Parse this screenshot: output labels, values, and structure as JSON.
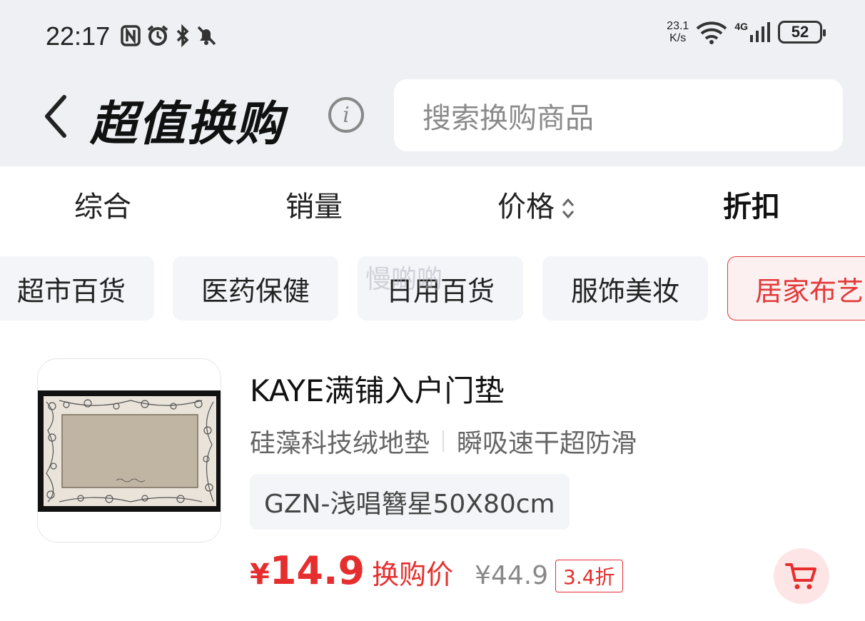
{
  "status_bar": {
    "time": "22:17",
    "net_speed_value": "23.1",
    "net_speed_unit": "K/s",
    "network_type": "4G",
    "battery": "52"
  },
  "header": {
    "title": "超值换购",
    "info_icon": "i",
    "search_placeholder": "搜索换购商品"
  },
  "sort_tabs": [
    {
      "label": "综合"
    },
    {
      "label": "销量"
    },
    {
      "label": "价格"
    },
    {
      "label": "折扣",
      "active": true
    }
  ],
  "categories": [
    {
      "label": "超市百货"
    },
    {
      "label": "医药保健"
    },
    {
      "label": "日用百货"
    },
    {
      "label": "服饰美妆"
    },
    {
      "label": "居家布艺",
      "active": true
    }
  ],
  "watermark": "慢啲啲",
  "product": {
    "name": "KAYE满铺入户门垫",
    "desc1": "硅藻科技绒地垫",
    "desc2": "瞬吸速干超防滑",
    "spec": "GZN-浅唱簪星50X80cm",
    "currency": "¥",
    "price": "14.9",
    "price_label": "换购价",
    "original_price": "¥44.9",
    "discount": "3.4折"
  },
  "colors": {
    "accent_red": "#e62e2e",
    "header_bg": "#eef0f4"
  },
  "icons": [
    "back-arrow-icon",
    "info-icon",
    "sort-arrows-icon",
    "cart-icon",
    "wifi-icon",
    "signal-icon",
    "battery-icon",
    "nfc-icon",
    "alarm-icon",
    "bluetooth-icon",
    "mute-icon"
  ]
}
